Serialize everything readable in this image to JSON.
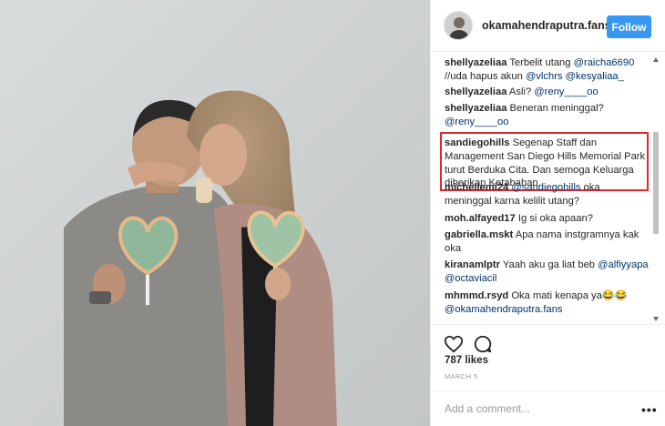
{
  "header": {
    "username": "okamahendraputra.fans",
    "follow_label": "Follow"
  },
  "comments": [
    {
      "user": "shellyazeliaa",
      "segments": [
        {
          "t": " Terbelit utang "
        },
        {
          "t": "@raicha6690",
          "m": true
        },
        {
          "t": " //uda hapus akun "
        },
        {
          "t": "@vlchrs",
          "m": true
        },
        {
          "t": " "
        },
        {
          "t": "@kesyaliaa_",
          "m": true
        }
      ]
    },
    {
      "user": "shellyazeliaa",
      "segments": [
        {
          "t": " Asli? "
        },
        {
          "t": "@reny____oo",
          "m": true
        }
      ]
    },
    {
      "user": "shellyazeliaa",
      "segments": [
        {
          "t": " Beneran meninggal? "
        },
        {
          "t": "@reny____oo",
          "m": true
        }
      ]
    },
    {
      "user": "sandiegohills",
      "segments": [
        {
          "t": " Segenap Staff dan Management San Diego Hills Memorial Park turut Berduka Cita. Dan semoga Keluarga diberikan Ketabahan."
        }
      ]
    },
    {
      "user": "michellemi24",
      "segments": [
        {
          "t": " "
        },
        {
          "t": "@sandiegohills",
          "m": true
        },
        {
          "t": " oka meninggal karna kelilit utang?"
        }
      ]
    },
    {
      "user": "moh.alfayed17",
      "segments": [
        {
          "t": " Ig si oka apaan?"
        }
      ]
    },
    {
      "user": "gabriella.mskt",
      "segments": [
        {
          "t": " Apa nama instgramnya kak oka"
        }
      ]
    },
    {
      "user": "kiranamlptr",
      "segments": [
        {
          "t": " Yaah aku ga liat beb "
        },
        {
          "t": "@alfiyyapa",
          "m": true
        },
        {
          "t": " "
        },
        {
          "t": "@octaviacil",
          "m": true
        }
      ]
    },
    {
      "user": "mhmmd.rsyd",
      "segments": [
        {
          "t": " Oka mati kenapa ya😂😂 "
        },
        {
          "t": "@okamahendraputra.fans",
          "m": true
        }
      ]
    }
  ],
  "actions": {
    "like_icon": "heart-icon",
    "comment_icon": "speech-bubble-icon",
    "likes": "787 likes",
    "date": "MARCH 5"
  },
  "add_comment": {
    "placeholder": "Add a comment...",
    "more_label": "•••"
  },
  "colors": {
    "follow_button": "#3897f0",
    "mention": "#003569",
    "highlight": "#e0272b"
  }
}
